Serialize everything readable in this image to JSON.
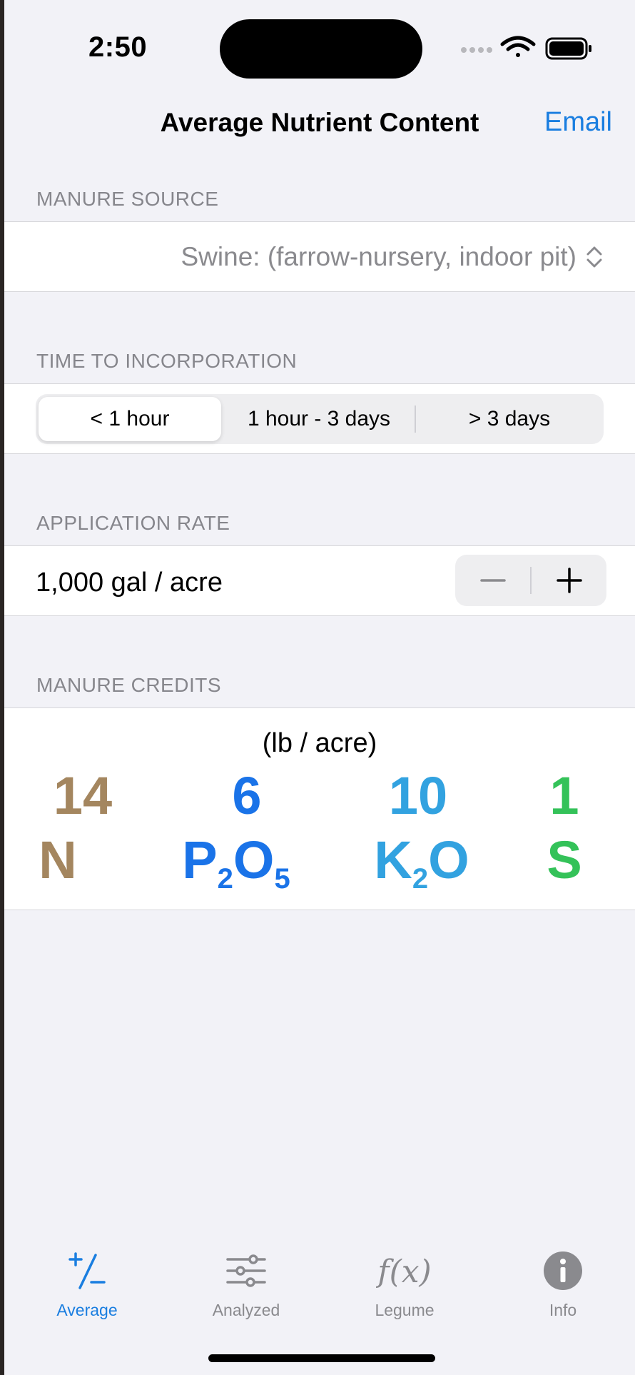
{
  "status_bar": {
    "time": "2:50"
  },
  "nav": {
    "title": "Average Nutrient Content",
    "email_label": "Email"
  },
  "manure_source": {
    "header": "MANURE SOURCE",
    "value": "Swine: (farrow-nursery, indoor pit)"
  },
  "incorporation": {
    "header": "TIME TO INCORPORATION",
    "options": [
      "< 1 hour",
      "1 hour - 3 days",
      "> 3 days"
    ],
    "selected": "< 1 hour"
  },
  "application_rate": {
    "header": "APPLICATION RATE",
    "value": "1,000 gal / acre"
  },
  "credits": {
    "header": "MANURE CREDITS",
    "units": "(lb / acre)",
    "n": {
      "value": "14",
      "label": "N",
      "color": "#a4865f"
    },
    "p": {
      "value": "6",
      "label_a": "P",
      "sub_a": "2",
      "label_b": "O",
      "sub_b": "5",
      "color": "#1a73e8"
    },
    "k": {
      "value": "10",
      "label_a": "K",
      "sub_a": "2",
      "label_b": "O",
      "color": "#32a2e0"
    },
    "s": {
      "value": "1",
      "label": "S",
      "color": "#34c259"
    }
  },
  "tabs": [
    {
      "label": "Average",
      "icon": "plus-minus-icon",
      "active": true
    },
    {
      "label": "Analyzed",
      "icon": "sliders-icon",
      "active": false
    },
    {
      "label": "Legume",
      "icon": "function-icon",
      "active": false
    },
    {
      "label": "Info",
      "icon": "info-icon",
      "active": false
    }
  ],
  "colors": {
    "accent": "#1a7ee0",
    "background": "#f2f2f7"
  }
}
